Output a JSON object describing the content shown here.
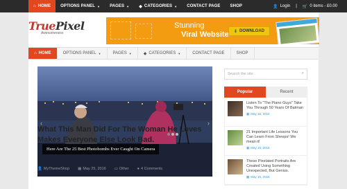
{
  "topnav": {
    "items": [
      {
        "label": "HOME",
        "icon": "home-icon",
        "caret": false,
        "active": true
      },
      {
        "label": "OPTIONS PANEL",
        "icon": "",
        "caret": true,
        "active": false
      },
      {
        "label": "PAGES",
        "icon": "",
        "caret": true,
        "active": false
      },
      {
        "label": "CATEGORIES",
        "icon": "tag-icon",
        "caret": true,
        "active": false
      },
      {
        "label": "CONTACT PAGE",
        "icon": "",
        "caret": false,
        "active": false
      },
      {
        "label": "SHOP",
        "icon": "",
        "caret": false,
        "active": false
      }
    ],
    "login": "Login",
    "cart": "0 items - £0.00"
  },
  "logo": {
    "brand_a": "True",
    "brand_b": "Pixel",
    "tagline": "Awesomeness"
  },
  "banner": {
    "line1": "Stunning",
    "line2": "Viral Website",
    "button": "DOWNLOAD",
    "accent": "#f39c12"
  },
  "mainnav": {
    "items": [
      {
        "label": "HOME",
        "active": true
      },
      {
        "label": "OPTIONS PANEL",
        "active": false
      },
      {
        "label": "PAGES",
        "active": false
      },
      {
        "label": "CATEGORIES",
        "active": false
      },
      {
        "label": "CONTACT PAGE",
        "active": false
      },
      {
        "label": "SHOP",
        "active": false
      }
    ]
  },
  "slider": {
    "caption": "Here Are The 25 Best Photobombs Ever Caught On Camera",
    "active_slide": 1,
    "slide_count": 3
  },
  "post": {
    "title": "What This Man Did For The Woman He Loves Makes Everyone Else Look Bad.",
    "author": "MyThemeShop",
    "date": "May 25, 2016",
    "category": "Other",
    "comments": "4 Comments"
  },
  "sidebar": {
    "search_placeholder": "Search the site",
    "tabs": [
      "Popular",
      "Recent"
    ],
    "active_tab": "Popular",
    "posts": [
      {
        "title": "Listen To \"The Piano Guys\" Take You Through 50 Years Of Batman",
        "date": "May 16, 2016",
        "color": "#5d4a3a"
      },
      {
        "title": "21 Important Life Lessons You Can Learn From Sheeps! We mean it!",
        "date": "May 16, 2016",
        "color": "#7fa35a"
      },
      {
        "title": "These Pixelated Portraits Are Created Using Something Unexpected, But Genius.",
        "date": "May 16, 2016",
        "color": "#8a6d4f"
      }
    ]
  },
  "colors": {
    "accent": "#e0481f",
    "topbar": "#2b2b2b",
    "link": "#3a98d3"
  }
}
